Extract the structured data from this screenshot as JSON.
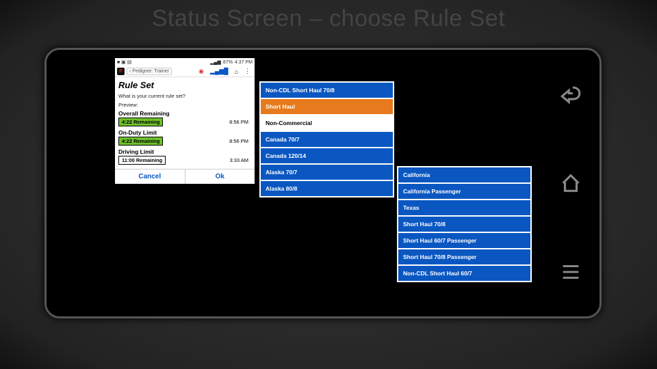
{
  "slide": {
    "title": "Status Screen – choose Rule Set"
  },
  "statusbar": {
    "time": "4:37 PM",
    "battery": "87%",
    "carrier_icons": "▂▄▆"
  },
  "app": {
    "breadcrumb": "‹ Pedigree: Trainer",
    "bars_icon": "▂▄▆█",
    "home_icon": "⌂",
    "menu_icon": "⋮",
    "err_icon": "◉"
  },
  "panel": {
    "title": "Rule Set",
    "question": "What is your current rule set?",
    "preview_label": "Preview:",
    "metrics": {
      "overall": {
        "name": "Overall Remaining",
        "badge": "4:22 Remaining",
        "time": "8:56 PM"
      },
      "onduty": {
        "name": "On-Duty Limit",
        "badge": "4:22 Remaining",
        "time": "8:56 PM"
      },
      "driving": {
        "name": "Driving Limit",
        "badge": "11:00 Remaining",
        "time": "3:33 AM"
      }
    },
    "cancel": "Cancel",
    "ok": "Ok"
  },
  "rules1": [
    "Non-CDL Short Haul 70/8",
    "Short Haul",
    "Non-Commercial",
    "Canada 70/7",
    "Canada 120/14",
    "Alaska 70/7",
    "Alaska 80/8"
  ],
  "rules2": [
    "California",
    "California Passenger",
    "Texas",
    "Short Haul 70/8",
    "Short Haul 60/7 Passenger",
    "Short Haul 70/8 Passenger",
    "Non-CDL Short Haul 60/7"
  ]
}
